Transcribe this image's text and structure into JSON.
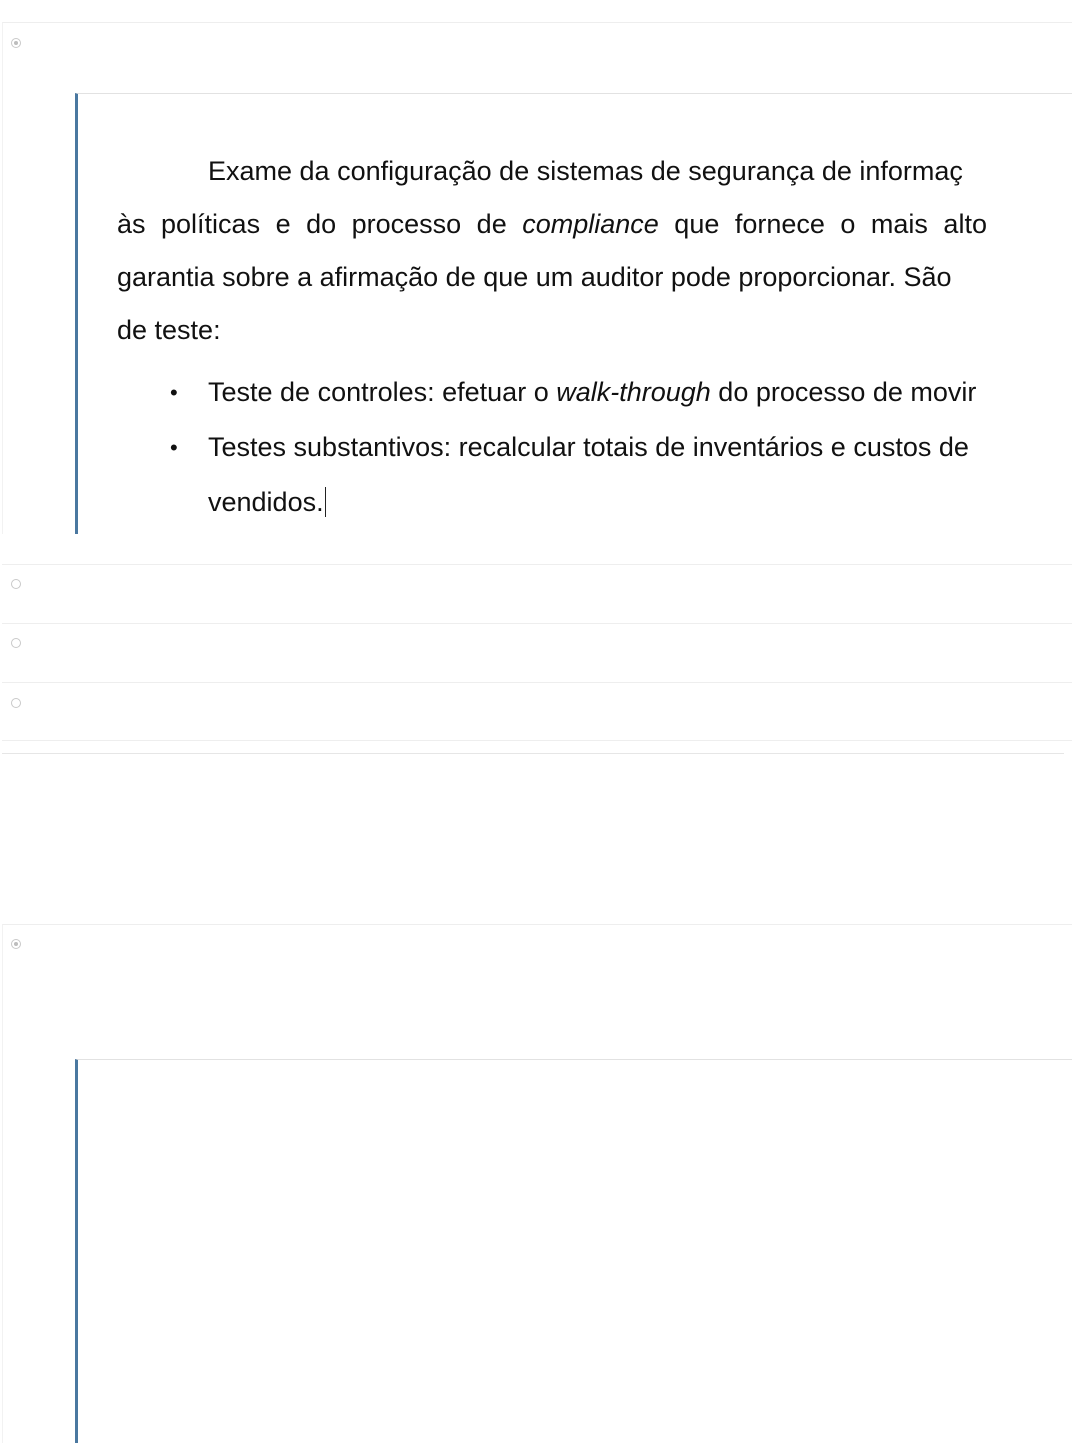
{
  "question_1": {
    "selected_option": 0,
    "answer": {
      "paragraph_line_1": "Exame da configuração de sistemas de segurança de informaç",
      "paragraph_line_2_a": "às políticas e do processo de ",
      "paragraph_line_2_em": "compliance",
      "paragraph_line_2_b": " que fornece o mais alto",
      "paragraph_line_3": "garantia sobre a afirmação de que um auditor pode proporcionar. São",
      "paragraph_line_4": "de teste:",
      "bullet_glyph": "•",
      "bullets": [
        {
          "text_a": "Teste de controles: efetuar o ",
          "text_em": "walk-through",
          "text_b": " do processo de movir"
        },
        {
          "text_line_1": "Testes substantivos: recalcular totais de inventários e custos de",
          "text_line_2": "vendidos."
        }
      ]
    },
    "other_option_count": 3
  },
  "question_2": {
    "selected_option": 0
  }
}
